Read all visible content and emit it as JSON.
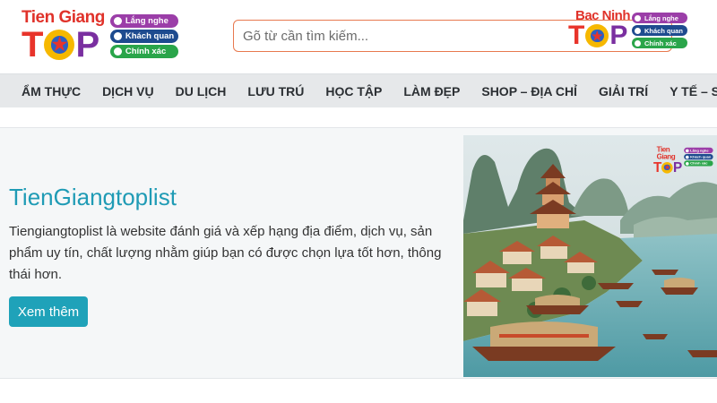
{
  "logo_main": {
    "place": "Tien Giang",
    "top_t": "T",
    "top_o": "★",
    "top_p": "P",
    "tags": [
      "Lắng nghe",
      "Khách quan",
      "Chính xác"
    ]
  },
  "logo_corner": {
    "place": "Bac Ninh",
    "top_t": "T",
    "top_o": "★",
    "top_p": "P",
    "tags": [
      "Lắng nghe",
      "Khách quan",
      "Chính xác"
    ]
  },
  "search": {
    "placeholder": "Gõ từ cần tìm kiếm..."
  },
  "nav": {
    "items": [
      "ẨM THỰC",
      "DỊCH VỤ",
      "DU LỊCH",
      "LƯU TRÚ",
      "HỌC TẬP",
      "LÀM ĐẸP",
      "SHOP – ĐỊA CHỈ",
      "GIẢI TRÍ",
      "Y TẾ – SỨC KHỎE"
    ]
  },
  "hero": {
    "title": "TienGiangtoplist",
    "description": "Tiengiangtoplist là website đánh giá và xếp hạng địa điểm, dịch vụ, sản phẩm uy tín, chất lượng nhằm giúp bạn có được chọn lựa tốt hơn, thông thái hơn.",
    "button_label": "Xem thêm"
  },
  "colors": {
    "accent": "#1fa2b9",
    "title": "#1f9bb5",
    "search_border": "#e8794f",
    "nav_bg": "#e6e8ea",
    "logo_red": "#e8342b",
    "logo_purple": "#7a2fa0"
  }
}
